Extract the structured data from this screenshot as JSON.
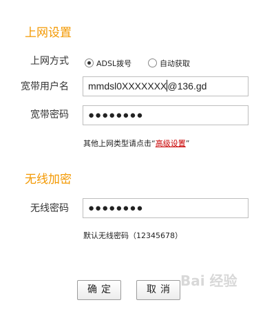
{
  "internet": {
    "title": "上网设置",
    "mode_label": "上网方式",
    "options": [
      {
        "label": "ADSL拨号",
        "checked": true
      },
      {
        "label": "自动获取",
        "checked": false
      }
    ],
    "username_label": "宽带用户名",
    "username_value": "mmdsl0XXXXXXX",
    "username_value_after_caret": "@136.gd",
    "password_label": "宽带密码",
    "password_value": "●●●●●●●●",
    "hint_prefix": "其他上网类型请点击“",
    "hint_link": "高级设置",
    "hint_suffix": "”"
  },
  "wireless": {
    "title": "无线加密",
    "password_label": "无线密码",
    "password_value": "●●●●●●●●",
    "default_hint": "默认无线密码（12345678）"
  },
  "buttons": {
    "confirm": "确定",
    "cancel": "取消"
  },
  "watermark": {
    "text": "Bai 经验"
  },
  "colors": {
    "section_title": "#f39800",
    "link": "#c80000"
  }
}
